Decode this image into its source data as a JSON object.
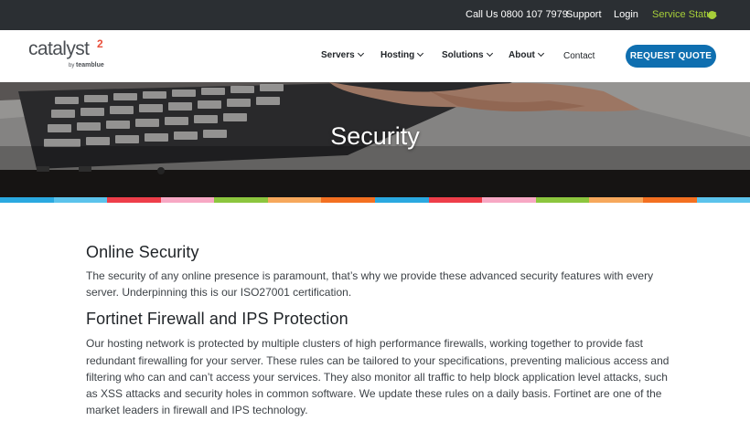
{
  "topbar": {
    "call_label": "Call Us 0800 107 7979",
    "support_label": "Support",
    "login_label": "Login",
    "status_label": "Service Status",
    "status_color": "#a6ce39"
  },
  "logo": {
    "word": "catalyst",
    "sup": "2",
    "by": "by",
    "brand": "teamblue"
  },
  "nav": {
    "items": [
      {
        "label": "Servers"
      },
      {
        "label": "Hosting"
      },
      {
        "label": "Solutions"
      },
      {
        "label": "About"
      },
      {
        "label": "Contact"
      }
    ],
    "cta_label": "REQUEST QUOTE",
    "cta_color": "#0f6fb0"
  },
  "hero": {
    "title": "Security"
  },
  "strip_colors": [
    "#2aa9e0",
    "#5bc3ec",
    "#ee3e4a",
    "#f7a8c4",
    "#8cc63e",
    "#f6a85c",
    "#f37021",
    "#2aa9e0",
    "#ee3e4a",
    "#f7a8c4",
    "#8cc63e",
    "#f6a85c",
    "#f37021",
    "#5bc3ec"
  ],
  "sections": [
    {
      "heading": "Online Security",
      "body": "The security of any online presence is paramount, that’s why we provide these advanced security features with every server. Underpinning this is our ISO27001 certification."
    },
    {
      "heading": "Fortinet Firewall and IPS Protection",
      "body": "Our hosting network is protected by multiple clusters of high performance firewalls, working together to provide fast redundant firewalling for your server. These rules can be tailored to your specifications, preventing malicious access and filtering who can and can’t access your services. They also monitor all traffic to help block application level attacks, such as XSS attacks and security holes in common software. We update these rules on a daily basis. Fortinet are one of the market leaders in firewall and IPS technology."
    }
  ]
}
